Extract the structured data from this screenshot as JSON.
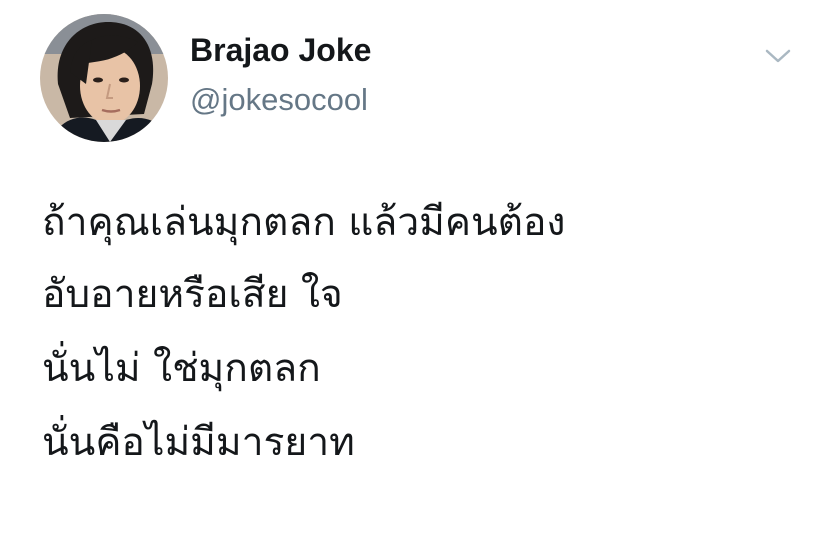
{
  "author": {
    "display_name": "Brajao Joke",
    "handle": "@jokesocool",
    "avatar_icon": "person-avatar"
  },
  "menu": {
    "icon": "chevron-down-icon",
    "color": "#aab8c2"
  },
  "tweet": {
    "lines": [
      "ถ้าคุณเล่นมุกตลก แล้วมีคนต้อง",
      "อับอายหรือเสีย ใจ",
      "นั่นไม่ ใช่มุกตลก",
      "นั่นคือไม่มีมารยาท"
    ]
  },
  "colors": {
    "name": "#14171a",
    "handle": "#657786",
    "text": "#14171a",
    "background": "#ffffff"
  }
}
